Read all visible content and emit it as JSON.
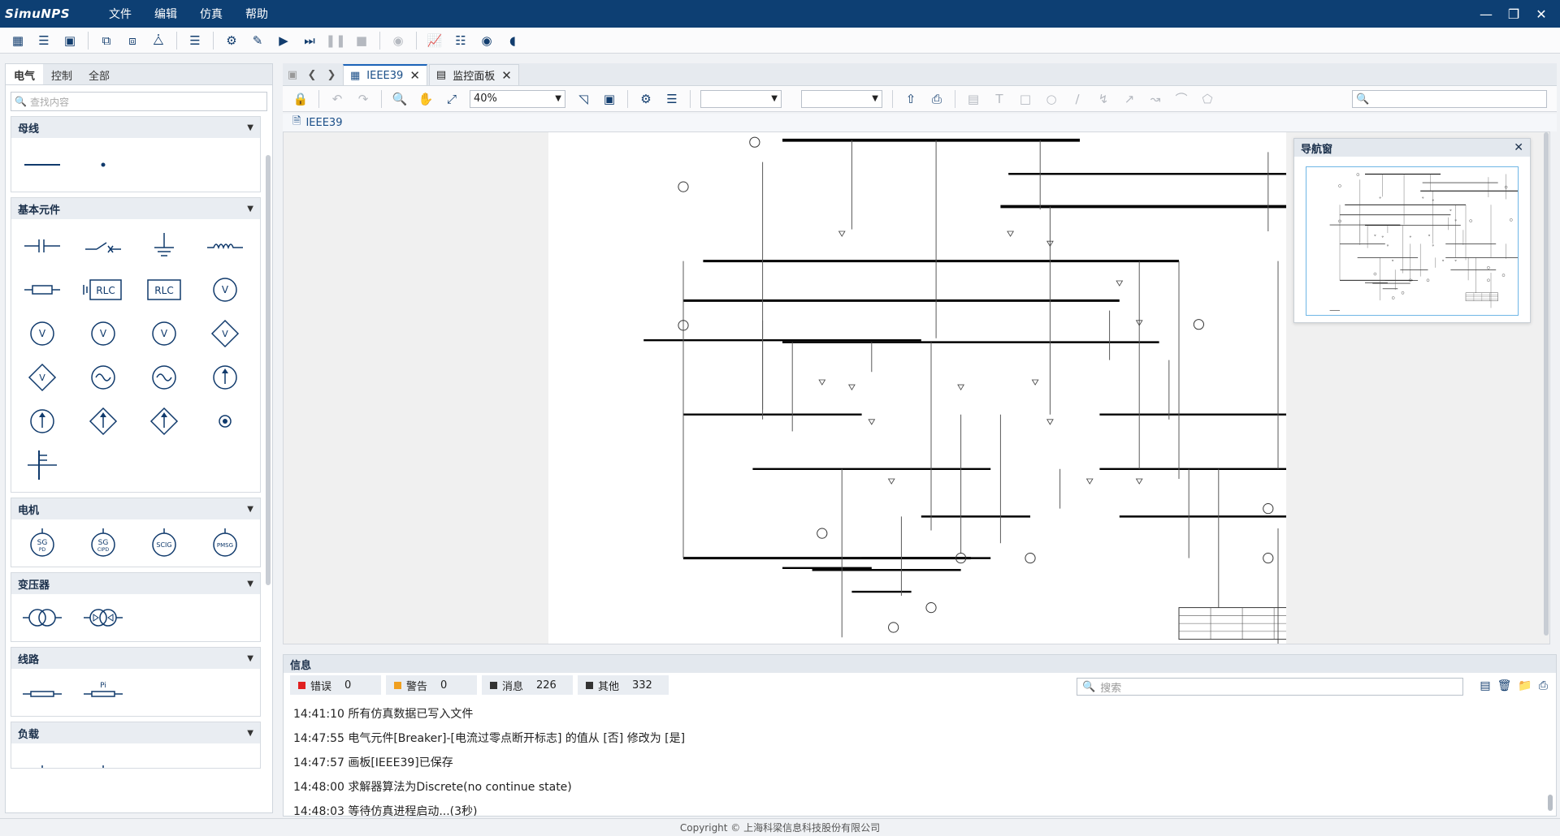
{
  "app": {
    "logo_text": "SimuNPS",
    "menu": [
      "文件",
      "编辑",
      "仿真",
      "帮助"
    ],
    "window_controls": [
      "minimize-icon",
      "restore-icon",
      "close-icon"
    ]
  },
  "toolbar": {
    "icons": [
      "layout-grid-icon",
      "list-icon",
      "panel-icon",
      "new-model-icon",
      "open-model-icon",
      "save-model-icon",
      "settings-sliders-icon",
      "compile-icon",
      "edit-icon",
      "play-icon",
      "step-icon",
      "pause-icon",
      "stop-icon",
      "debug-icon",
      "chart-icon",
      "tuning-icon",
      "monitor-icon",
      "headset-icon"
    ]
  },
  "library": {
    "tabs": [
      "电气",
      "控制",
      "全部"
    ],
    "active_tab": "电气",
    "search_placeholder": "查找内容",
    "categories": [
      {
        "title": "母线"
      },
      {
        "title": "基本元件"
      },
      {
        "title": "电机"
      },
      {
        "title": "变压器"
      },
      {
        "title": "线路"
      },
      {
        "title": "负载"
      }
    ],
    "rlc_label": "RLC",
    "v_label": "V",
    "machines": [
      "SG PD",
      "SG CIPD",
      "SCIG",
      "PMSG"
    ],
    "line_pi_label": "Pi"
  },
  "doc_tabs": [
    {
      "label": "IEEE39",
      "active": true
    },
    {
      "label": "监控面板",
      "active": false
    }
  ],
  "doc_toolbar": {
    "zoom": "40%",
    "combo1": "",
    "combo2": "",
    "search_placeholder": ""
  },
  "breadcrumb": "IEEE39",
  "navigator": {
    "title": "导航窗"
  },
  "info": {
    "title": "信息",
    "filters": [
      {
        "label": "错误",
        "count": "0",
        "color": "#e02020"
      },
      {
        "label": "警告",
        "count": "0",
        "color": "#f0a020"
      },
      {
        "label": "消息",
        "count": "226",
        "color": "#333333"
      },
      {
        "label": "其他",
        "count": "332",
        "color": "#333333"
      }
    ],
    "search_placeholder": "搜索",
    "log": [
      "14:41:10 所有仿真数据已写入文件",
      "14:47:55 电气元件[Breaker]-[电流过零点断开标志] 的值从 [否] 修改为 [是]",
      "14:47:57 画板[IEEE39]已保存",
      "14:48:00 求解器算法为Discrete(no continue state)",
      "14:48:03 等待仿真进程启动...(3秒)"
    ]
  },
  "footer": "Copyright © 上海科梁信息科技股份有限公司",
  "colors": {
    "titlebar": "#0d3f73",
    "accent": "#1b63b8",
    "icon": "#123d6e"
  }
}
